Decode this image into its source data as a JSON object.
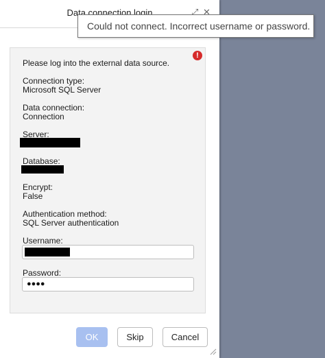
{
  "dialog": {
    "title": "Data connection login"
  },
  "tooltip": {
    "message": "Could not connect. Incorrect username or password."
  },
  "form": {
    "intro": "Please log into the external data source.",
    "connection_type_label": "Connection type:",
    "connection_type_value": "Microsoft SQL Server",
    "data_connection_label": "Data connection:",
    "data_connection_value": "Connection",
    "server_label": "Server:",
    "database_label": "Database:",
    "encrypt_label": "Encrypt:",
    "encrypt_value": "False",
    "auth_method_label": "Authentication method:",
    "auth_method_value": "SQL Server authentication",
    "username_label": "Username:",
    "password_label": "Password:",
    "password_value": "●●●●"
  },
  "buttons": {
    "ok": "OK",
    "skip": "Skip",
    "cancel": "Cancel"
  },
  "icons": {
    "error": "error-icon",
    "expand": "expand-icon",
    "close": "close-icon",
    "resize": "resize-grip-icon"
  },
  "colors": {
    "error": "#d62b2b",
    "ok_button": "#a8c0f0",
    "backdrop": "#7a8499"
  }
}
